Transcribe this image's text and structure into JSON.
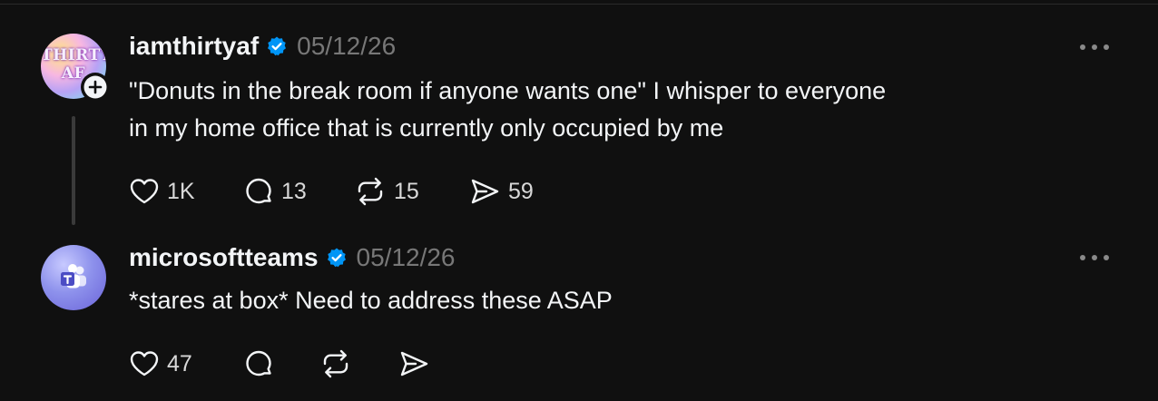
{
  "colors": {
    "background": "#101010",
    "text": "#f3f5f7",
    "muted": "#777777",
    "verified": "#0095f6",
    "thread_line": "#3a3a3a"
  },
  "posts": [
    {
      "avatar": {
        "text": "THIRTY AF",
        "icon": "profile-avatar",
        "badge_icon": "follow-plus-icon"
      },
      "username": "iamthirtyaf",
      "verified_icon": "verified-badge-icon",
      "date": "05/12/26",
      "text": "\"Donuts in the break room if anyone wants one\" I whisper to everyone\nin my home office that is currently only occupied by me",
      "more_icon": "more-options-icon",
      "actions": {
        "like": {
          "icon": "heart-icon",
          "count": "1K"
        },
        "comment": {
          "icon": "comment-icon",
          "count": "13"
        },
        "repost": {
          "icon": "repost-icon",
          "count": "15"
        },
        "share": {
          "icon": "send-icon",
          "count": "59"
        }
      }
    },
    {
      "avatar": {
        "icon": "microsoft-teams-logo"
      },
      "username": "microsoftteams",
      "verified_icon": "verified-badge-icon",
      "date": "05/12/26",
      "text": "*stares at box* Need to address these ASAP",
      "more_icon": "more-options-icon",
      "actions": {
        "like": {
          "icon": "heart-icon",
          "count": "47"
        },
        "comment": {
          "icon": "comment-icon",
          "count": ""
        },
        "repost": {
          "icon": "repost-icon",
          "count": ""
        },
        "share": {
          "icon": "send-icon",
          "count": ""
        }
      }
    }
  ]
}
